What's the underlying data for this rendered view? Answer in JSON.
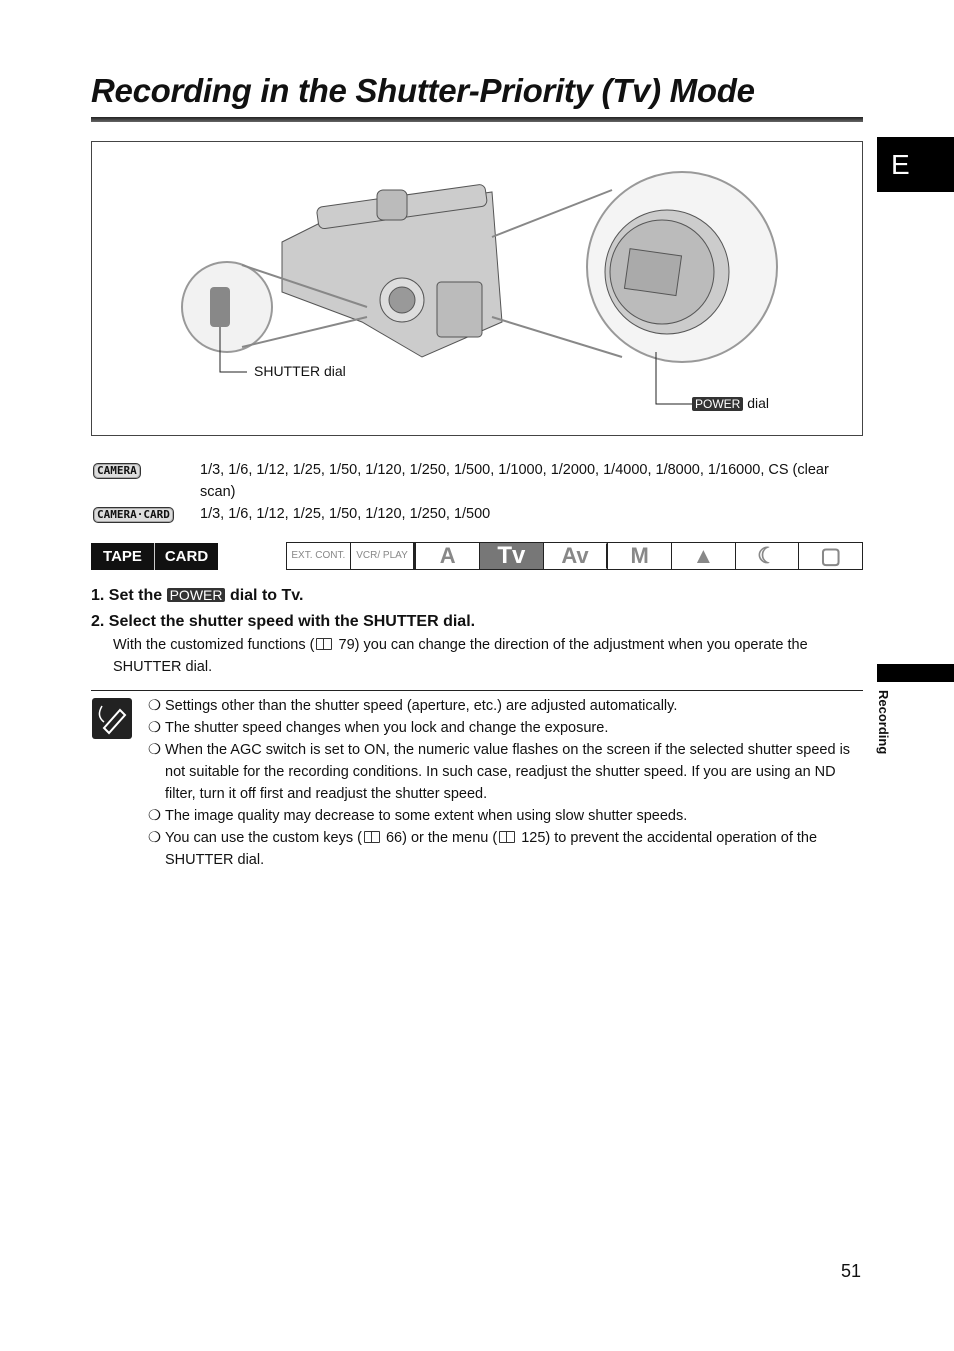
{
  "header": {
    "title": "Recording in the Shutter-Priority (Tv) Mode",
    "language_tab": "E"
  },
  "figure": {
    "shutter_label": "SHUTTER dial",
    "power_badge": "POWER",
    "power_suffix": "dial"
  },
  "speeds": {
    "camera_badge": "CAMERA",
    "camera_values": "1/3, 1/6, 1/12, 1/25, 1/50, 1/120, 1/250, 1/500, 1/1000, 1/2000, 1/4000, 1/8000, 1/16000, CS (clear scan)",
    "camera_card_badge": "CAMERA·CARD",
    "camera_card_values": "1/3, 1/6, 1/12, 1/25, 1/50, 1/120, 1/250, 1/500"
  },
  "media": [
    "TAPE",
    "CARD"
  ],
  "dial_modes": [
    "EXT. CONT.",
    "VCR/ PLAY",
    "A",
    "Tv",
    "Av",
    "M",
    "▲",
    "☾",
    "▢"
  ],
  "steps": [
    {
      "num": "1.",
      "pre": "Set the",
      "badge": "POWER",
      "post": "dial to Tv."
    },
    {
      "num": "2.",
      "text": "Select the shutter speed with the SHUTTER dial."
    }
  ],
  "step2_desc": {
    "pre": "With the customized functions (",
    "post": " 79) you can change the direction of the adjustment when you operate the SHUTTER dial."
  },
  "notes": [
    "Settings other than the shutter speed (aperture, etc.) are adjusted automatically.",
    "The shutter speed changes when you lock and change the exposure.",
    "When the AGC switch is set to ON, the numeric value flashes on the screen if the selected shutter speed is not suitable for the recording conditions. In such case, readjust the shutter speed. If you are using an ND filter, turn it off first and readjust the shutter speed.",
    "The image quality may decrease to some extent when using slow shutter speeds."
  ],
  "note5": {
    "a": "You can use the custom keys (",
    "b": " 66) or the menu (",
    "c": " 125) to prevent the accidental operation of the SHUTTER dial."
  },
  "bullet": "❍",
  "side_label": "Recording",
  "page_number": "51"
}
